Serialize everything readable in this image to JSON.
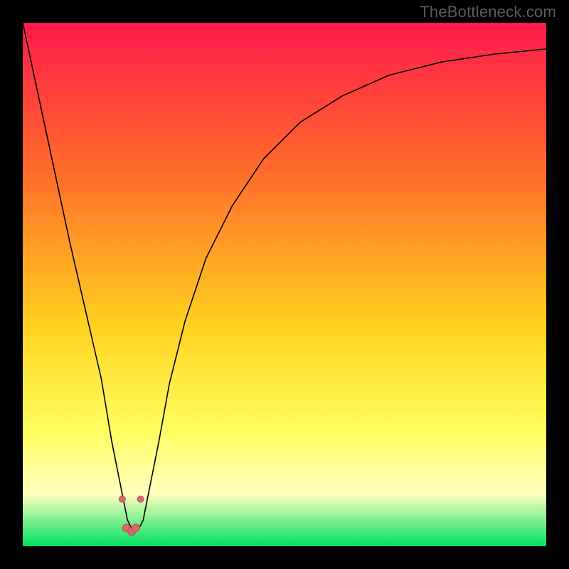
{
  "watermark": "TheBottleneck.com",
  "colors": {
    "frame": "#000000",
    "grad_top": "#ff1a4b",
    "grad_mid1": "#ff6a2a",
    "grad_mid2": "#ffd21f",
    "grad_mid3": "#ffff60",
    "grad_mid4": "#ffffc0",
    "grad_bottom": "#00e060",
    "curve": "#000000",
    "marker_fill": "#d46a6a",
    "marker_stroke": "#c25252"
  },
  "chart_data": {
    "type": "line",
    "title": "",
    "xlabel": "",
    "ylabel": "",
    "xlim": [
      0,
      100
    ],
    "ylim": [
      0,
      100
    ],
    "note": "x runs 0..100 across plot width; y is bottleneck magnitude 0 (bottom/green) .. 100 (top/red). No numeric axes are drawn in the image; values are estimated from curve geometry.",
    "series": [
      {
        "name": "bottleneck-curve",
        "x": [
          0,
          3,
          6,
          9,
          12,
          15,
          17,
          19,
          20,
          21,
          22,
          23,
          24,
          26,
          28,
          31,
          35,
          40,
          46,
          53,
          61,
          70,
          80,
          90,
          100
        ],
        "y": [
          100,
          86,
          72,
          58,
          45,
          32,
          20,
          10,
          5,
          3,
          3,
          5,
          10,
          20,
          31,
          43,
          55,
          65,
          74,
          81,
          86,
          90,
          92.5,
          94,
          95
        ]
      }
    ],
    "markers": [
      {
        "x": 19.0,
        "y": 9.0,
        "r": 4.5
      },
      {
        "x": 19.8,
        "y": 3.5,
        "r": 5.5
      },
      {
        "x": 20.8,
        "y": 2.8,
        "r": 5.5
      },
      {
        "x": 21.6,
        "y": 3.5,
        "r": 5.5
      },
      {
        "x": 22.5,
        "y": 9.0,
        "r": 4.5
      }
    ],
    "min_point": {
      "x": 20.8,
      "y": 2.8
    }
  }
}
